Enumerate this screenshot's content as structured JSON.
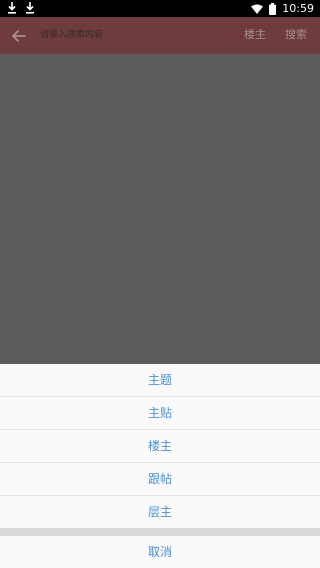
{
  "statusbar": {
    "time": "10:59"
  },
  "toolbar": {
    "search_placeholder": "请输入搜索内容",
    "filter_label": "楼主",
    "search_label": "搜索"
  },
  "sheet": {
    "options": [
      {
        "label": "主题"
      },
      {
        "label": "主贴"
      },
      {
        "label": "楼主"
      },
      {
        "label": "跟帖"
      },
      {
        "label": "层主"
      }
    ],
    "cancel_label": "取消"
  },
  "colors": {
    "toolbar_bg": "#6e3b3e",
    "overlay": "#5c5c5c",
    "option_text": "#4a90d9"
  }
}
